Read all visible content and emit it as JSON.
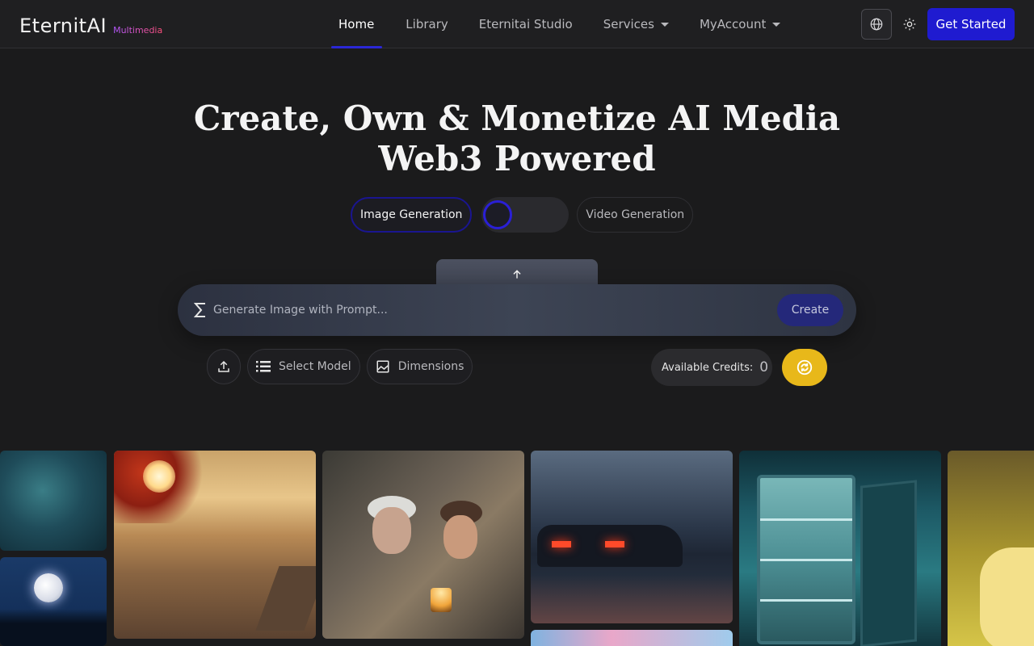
{
  "nav": {
    "logo_main": "EternitAI",
    "logo_sub": "Multimedia",
    "links": [
      {
        "label": "Home",
        "active": true
      },
      {
        "label": "Library"
      },
      {
        "label": "Eternitai Studio"
      },
      {
        "label": "Services",
        "dropdown": true
      },
      {
        "label": "MyAccount",
        "dropdown": true
      }
    ],
    "globe_icon": "globe-icon",
    "theme_icon": "sun-icon",
    "cta": "Get Started"
  },
  "hero": {
    "title_line1": "Create, Own & Monetize AI Media",
    "title_line2": "Web3 Powered"
  },
  "mode_toggle": {
    "left_label": "Image Generation",
    "right_label": "Video Generation",
    "selected": "Image Generation"
  },
  "prompt": {
    "placeholder": "Generate Image with Prompt...",
    "value": "",
    "create_label": "Create"
  },
  "tools": {
    "upload_icon": "upload-icon",
    "select_model": "Select Model",
    "dimensions": "Dimensions"
  },
  "credits": {
    "label": "Available Credits:",
    "value": "0"
  },
  "colors": {
    "accent": "#1f1bd0",
    "gold": "#e8b81a",
    "background": "#1b1b1c"
  }
}
